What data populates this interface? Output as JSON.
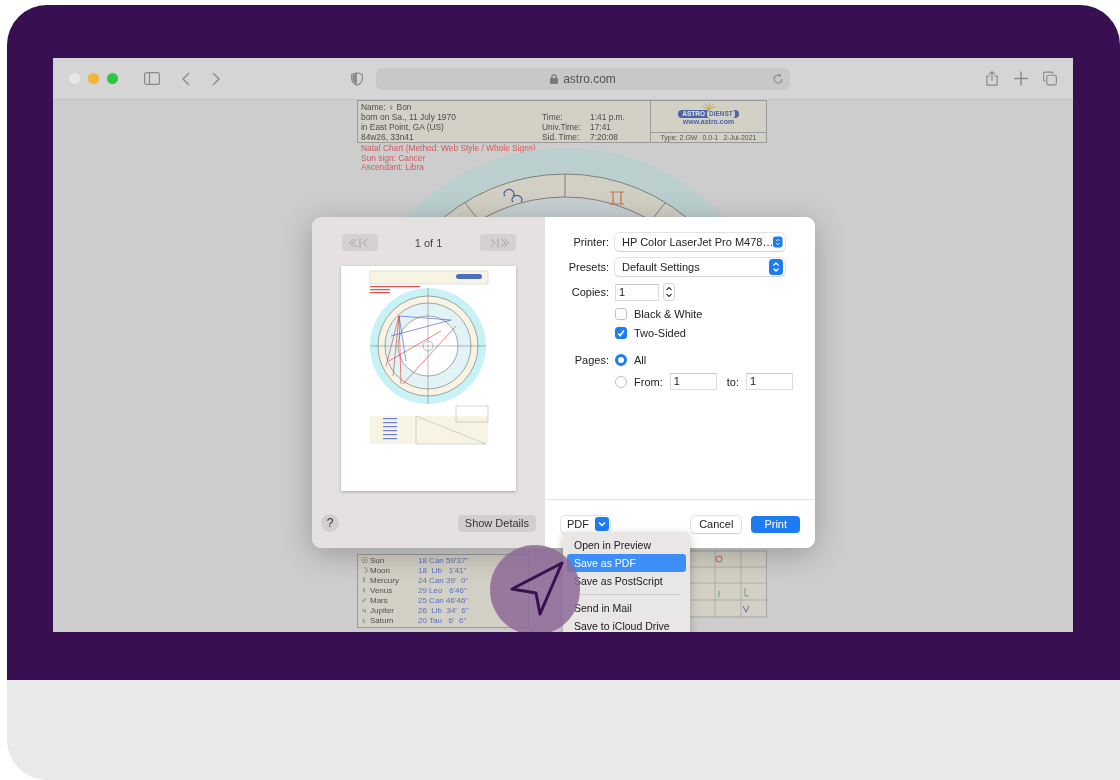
{
  "browser": {
    "url": "astro.com"
  },
  "chart_page": {
    "details": [
      "Name:  ♀ Bon",
      "born on Sa., 11 July 1970",
      "in East Point, GA (US)",
      "84w26, 33n41"
    ],
    "times": [
      {
        "label": "Time:",
        "value": "1:41 p.m."
      },
      {
        "label": "Univ.Time:",
        "value": "17:41"
      },
      {
        "label": "Sid. Time:",
        "value": "7:20:08"
      }
    ],
    "logo": {
      "word_1": "ASTRO",
      "word_2": "DIENST",
      "site": "www.astro.com"
    },
    "chart_info": [
      "Type: 2.GW",
      "0.0-1",
      "2-Jul-2021"
    ],
    "summary": [
      "Natal Chart  (Method: Web Style / Whole Signs)",
      "Sun sign: Cancer",
      "Ascendant: Libra"
    ],
    "planets": [
      {
        "glyph": "☉",
        "name": "Sun",
        "position": "18 Can 59'37\""
      },
      {
        "glyph": "☽",
        "name": "Moon",
        "position": "18  Lib   1'41\""
      },
      {
        "glyph": "☿",
        "name": "Mercury",
        "position": "24 Can 39'  0\""
      },
      {
        "glyph": "♀",
        "name": "Venus",
        "position": "29 Leo   6'46\""
      },
      {
        "glyph": "♂",
        "name": "Mars",
        "position": "25 Can 46'46\""
      },
      {
        "glyph": "♃",
        "name": "Jupiter",
        "position": "26  Lib  34'  6\""
      },
      {
        "glyph": "♄",
        "name": "Saturn",
        "position": "20 Tau   6'  6\""
      }
    ]
  },
  "print_dialog": {
    "page_counter": "1 of 1",
    "help": "?",
    "show_details": "Show Details",
    "printer": {
      "label": "Printer:",
      "value": "HP Color LaserJet Pro M478…"
    },
    "presets": {
      "label": "Presets:",
      "value": "Default Settings"
    },
    "copies": {
      "label": "Copies:",
      "value": "1"
    },
    "options": [
      {
        "label": "Black & White",
        "checked": false
      },
      {
        "label": "Two-Sided",
        "checked": true
      }
    ],
    "pages": {
      "label": "Pages:",
      "choices": [
        {
          "label": "All",
          "selected": true
        },
        {
          "label": "From:",
          "selected": false
        }
      ],
      "from": "1",
      "to_label": "to:",
      "to": "1"
    },
    "pdf_button": "PDF",
    "cancel_button": "Cancel",
    "print_button": "Print"
  },
  "pdf_menu": [
    {
      "kind": "item",
      "label": "Open in Preview",
      "selected": false
    },
    {
      "kind": "item",
      "label": "Save as PDF",
      "selected": true
    },
    {
      "kind": "item",
      "label": "Save as PostScript",
      "selected": false
    },
    {
      "kind": "separator"
    },
    {
      "kind": "item",
      "label": "Send in Mail",
      "selected": false
    },
    {
      "kind": "item",
      "label": "Save to iCloud Drive",
      "selected": false
    }
  ]
}
